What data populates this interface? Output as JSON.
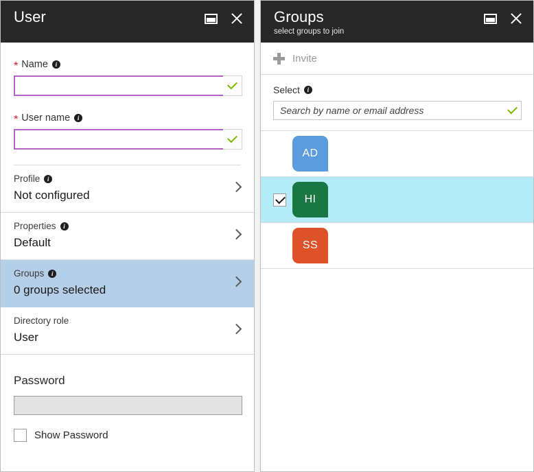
{
  "user_blade": {
    "title": "User",
    "header_actions": [
      {
        "name": "maximize",
        "label": "Maximize"
      },
      {
        "name": "close",
        "label": "Close"
      }
    ],
    "fields": [
      {
        "label": "Name",
        "required": true,
        "has_info": true,
        "value": "",
        "placeholder": "",
        "valid": true
      },
      {
        "label": "User name",
        "required": true,
        "has_info": true,
        "value": "",
        "placeholder": "",
        "valid": true
      }
    ],
    "nav_rows": [
      {
        "title": "Profile",
        "has_info": true,
        "value": "Not configured",
        "selected": false
      },
      {
        "title": "Properties",
        "has_info": true,
        "value": "Default",
        "selected": false
      },
      {
        "title": "Groups",
        "has_info": true,
        "value": "0 groups selected",
        "selected": true
      },
      {
        "title": "Directory role",
        "has_info": false,
        "value": "User",
        "selected": false
      }
    ],
    "password": {
      "heading": "Password",
      "value": "",
      "show_password_label": "Show Password",
      "show_password_checked": false
    }
  },
  "groups_blade": {
    "title": "Groups",
    "subtitle": "select groups to join",
    "toolbar": {
      "invite_label": "Invite"
    },
    "select": {
      "label": "Select",
      "has_info": true,
      "search_value": "",
      "search_placeholder": "Search by name or email address",
      "valid": true
    },
    "groups": [
      {
        "initials": "AD",
        "color": "#5c9bdd",
        "selected": false
      },
      {
        "initials": "HI",
        "color": "#197744",
        "selected": true
      },
      {
        "initials": "SS",
        "color": "#de5229",
        "selected": false
      }
    ]
  },
  "colors": {
    "header_bg": "#272727",
    "selected_nav": "#b4cfe7",
    "selected_row": "#b3ecf7",
    "input_border": "#b262c4",
    "check_green": "#7cb700",
    "required_red": "#e81123"
  }
}
